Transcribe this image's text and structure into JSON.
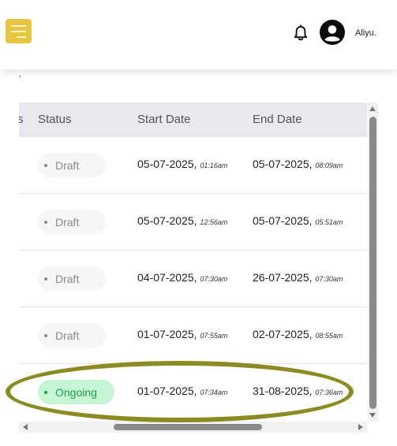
{
  "header": {
    "username": "Aliyu.",
    "menu_icon": "hamburger-menu-icon",
    "notification_icon": "bell-icon",
    "avatar_icon": "user-avatar-icon",
    "accent_color": "#e8c53f"
  },
  "page": {
    "cut_text": "‚"
  },
  "table": {
    "columns": [
      "ts",
      "Status",
      "Start Date",
      "End Date"
    ],
    "rows": [
      {
        "status": "Draft",
        "start_date": "05-07-2025,",
        "start_time": "01:16am",
        "end_date": "05-07-2025,",
        "end_time": "08:09am"
      },
      {
        "status": "Draft",
        "start_date": "05-07-2025,",
        "start_time": "12:56am",
        "end_date": "05-07-2025,",
        "end_time": "05:51am"
      },
      {
        "status": "Draft",
        "start_date": "04-07-2025,",
        "start_time": "07:30am",
        "end_date": "26-07-2025,",
        "end_time": "07:30am"
      },
      {
        "status": "Draft",
        "start_date": "01-07-2025,",
        "start_time": "07:55am",
        "end_date": "02-07-2025,",
        "end_time": "08:55am"
      },
      {
        "status": "Ongoing",
        "start_date": "01-07-2025,",
        "start_time": "07:34am",
        "end_date": "31-08-2025,",
        "end_time": "07:36am"
      }
    ],
    "status_colors": {
      "Draft": {
        "bg": "#f6f6f6",
        "fg": "#8a8a8a"
      },
      "Ongoing": {
        "bg": "#c6f7d4",
        "fg": "#1e9f49"
      }
    }
  },
  "annotation": {
    "highlight_color": "#8b8b22",
    "highlighted_row": 5
  }
}
